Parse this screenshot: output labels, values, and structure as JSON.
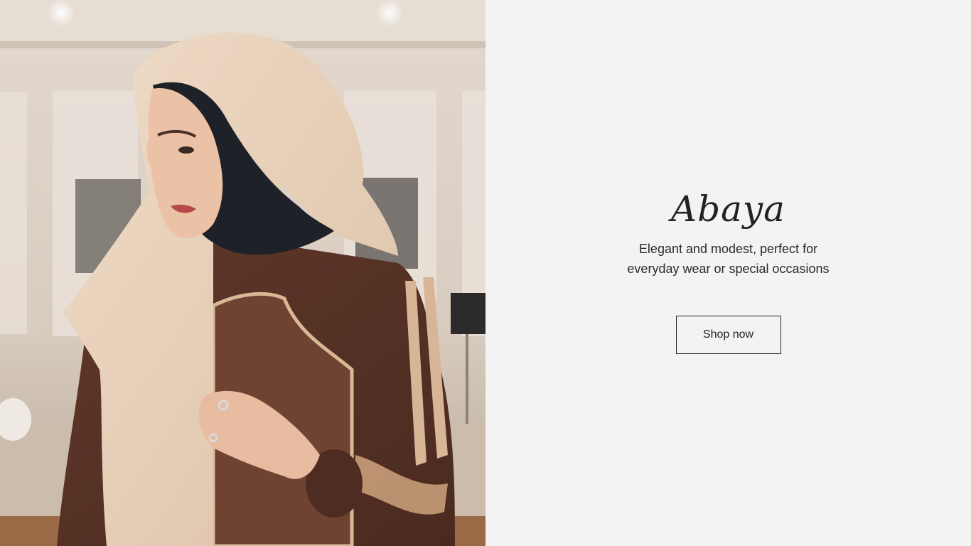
{
  "hero": {
    "title": "Abaya",
    "subtitle": "Elegant and modest, perfect for everyday wear or special occasions",
    "button_label": "Shop now"
  },
  "image": {
    "description_icon": "model-photo",
    "colors": {
      "background": "#d9cfc4",
      "hijab": "#e8d2bd",
      "inner_scarf": "#1e2128",
      "abaya": "#5a3328",
      "accent": "#c9a27f",
      "skin": "#e9bfa3"
    }
  },
  "colors": {
    "panel_bg": "#f3f3f3",
    "text": "#222222"
  }
}
